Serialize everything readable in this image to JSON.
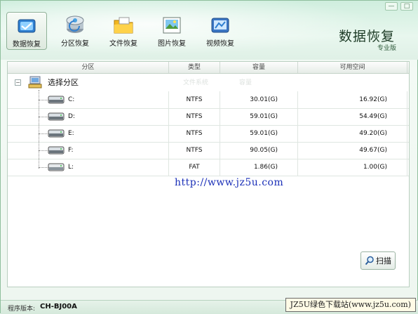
{
  "window": {
    "minimize_glyph": "—",
    "close_glyph": "□"
  },
  "toolbar": {
    "items": [
      {
        "label": "数据恢复",
        "icon": "data-recovery-icon",
        "active": true
      },
      {
        "label": "分区恢复",
        "icon": "partition-recovery-icon",
        "active": false
      },
      {
        "label": "文件恢复",
        "icon": "folder-icon",
        "active": false
      },
      {
        "label": "图片恢复",
        "icon": "picture-icon",
        "active": false
      },
      {
        "label": "视频恢复",
        "icon": "video-icon",
        "active": false
      }
    ]
  },
  "title": {
    "main": "数据恢复",
    "sub": "专业版"
  },
  "table": {
    "headers": [
      "分区",
      "类型",
      "容量",
      "可用空间"
    ],
    "root": {
      "expander": "−",
      "label": "选择分区"
    },
    "rows": [
      {
        "name": "C:",
        "type": "NTFS",
        "capacity": "30.01(G)",
        "free": "16.92(G)"
      },
      {
        "name": "D:",
        "type": "NTFS",
        "capacity": "59.01(G)",
        "free": "54.49(G)"
      },
      {
        "name": "E:",
        "type": "NTFS",
        "capacity": "59.01(G)",
        "free": "49.20(G)"
      },
      {
        "name": "F:",
        "type": "NTFS",
        "capacity": "90.05(G)",
        "free": "49.67(G)"
      },
      {
        "name": "L:",
        "type": "FAT",
        "capacity": "1.86(G)",
        "free": "1.00(G)"
      }
    ]
  },
  "watermark": {
    "url": "http://www.jz5u.com",
    "banner": "JZ5U绿色下载站(www.jz5u.com)"
  },
  "scan_button": {
    "label": "扫描",
    "icon": "magnifier-icon"
  },
  "status": {
    "version_label": "程序版本:",
    "version_value": "CH-BJ00A"
  },
  "colors": {
    "accent": "#2e7d4a",
    "url_blue": "#1a2fb8"
  }
}
